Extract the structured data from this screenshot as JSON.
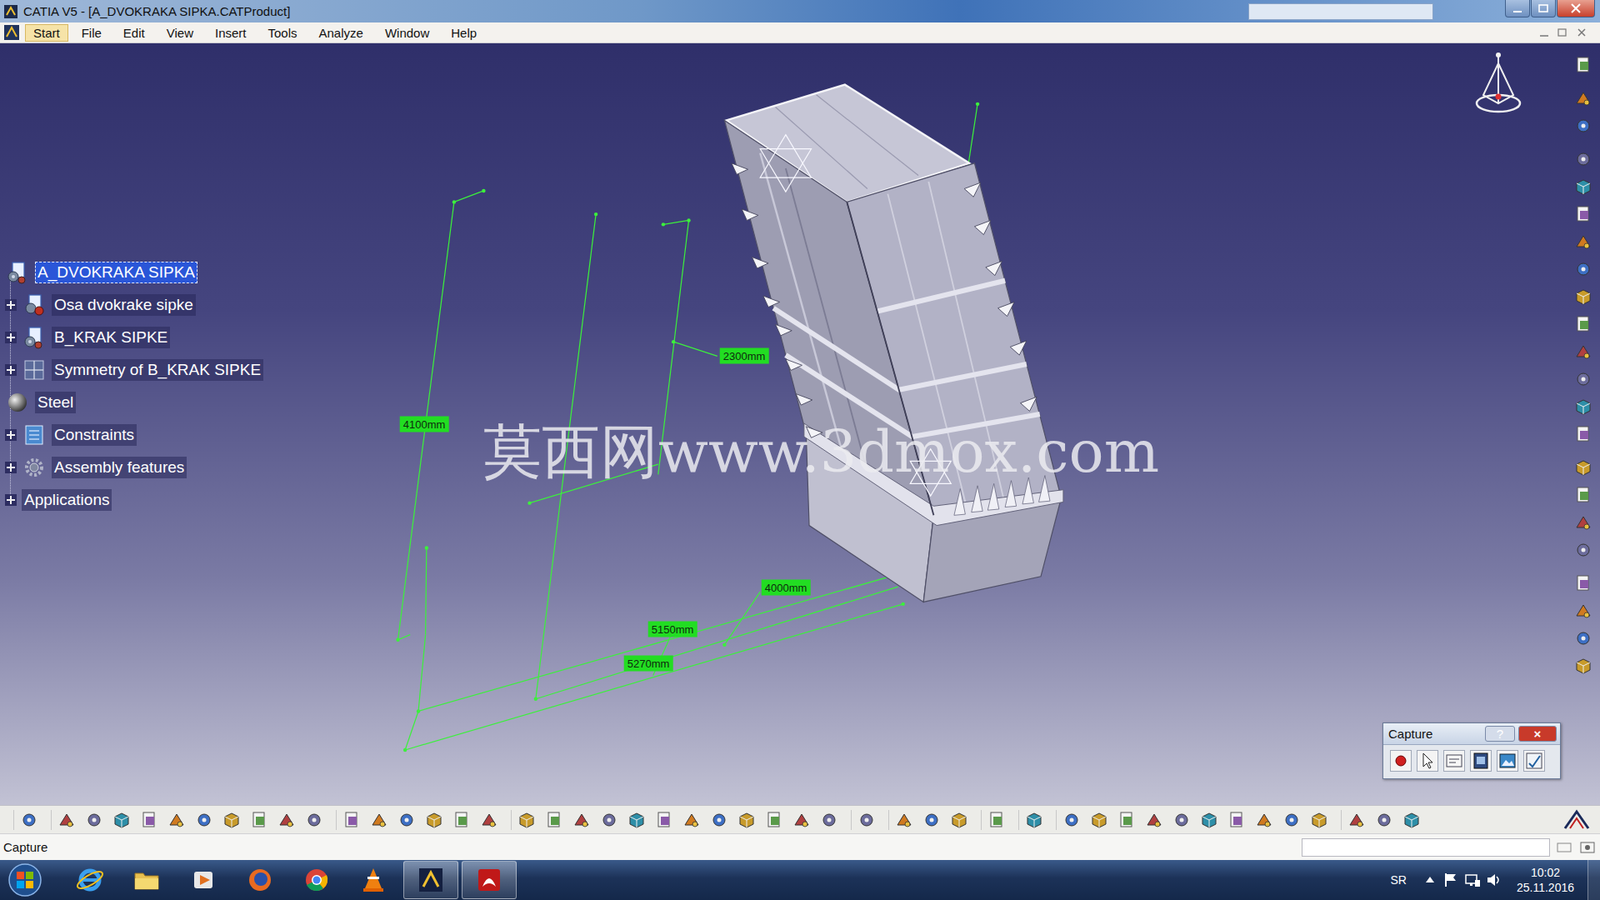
{
  "window": {
    "title": "CATIA V5 - [A_DVOKRAKA SIPKA.CATProduct]"
  },
  "menu": [
    {
      "label": "Start",
      "selected": true
    },
    {
      "label": "File",
      "selected": false
    },
    {
      "label": "Edit",
      "selected": false
    },
    {
      "label": "View",
      "selected": false
    },
    {
      "label": "Insert",
      "selected": false
    },
    {
      "label": "Tools",
      "selected": false
    },
    {
      "label": "Analyze",
      "selected": false
    },
    {
      "label": "Window",
      "selected": false
    },
    {
      "label": "Help",
      "selected": false
    }
  ],
  "tree": {
    "items": [
      {
        "label": "A_DVOKRAKA SIPKA",
        "kind": "product",
        "expandable": false,
        "selected": true
      },
      {
        "label": "Osa dvokrake sipke",
        "kind": "part",
        "expandable": true,
        "selected": false
      },
      {
        "label": "B_KRAK SIPKE",
        "kind": "product",
        "expandable": true,
        "selected": false
      },
      {
        "label": "Symmetry of B_KRAK SIPKE",
        "kind": "symmetry",
        "expandable": true,
        "selected": false
      },
      {
        "label": "Steel",
        "kind": "material",
        "expandable": false,
        "selected": false
      },
      {
        "label": "Constraints",
        "kind": "constraints",
        "expandable": true,
        "selected": false
      },
      {
        "label": "Assembly features",
        "kind": "features",
        "expandable": true,
        "selected": false
      },
      {
        "label": "Applications",
        "kind": "applications",
        "expandable": true,
        "selected": false
      }
    ]
  },
  "dimensions": [
    "4100mm",
    "2300mm",
    "4000mm",
    "5150mm",
    "5270mm"
  ],
  "watermark": "莫西网www.3dmox.com",
  "capture_toolbar": {
    "title": "Capture",
    "help": "?",
    "close": "×"
  },
  "status_bar": {
    "text": "Capture"
  },
  "taskbar": {
    "language": "SR",
    "time": "10:02",
    "date": "25.11.2016"
  }
}
